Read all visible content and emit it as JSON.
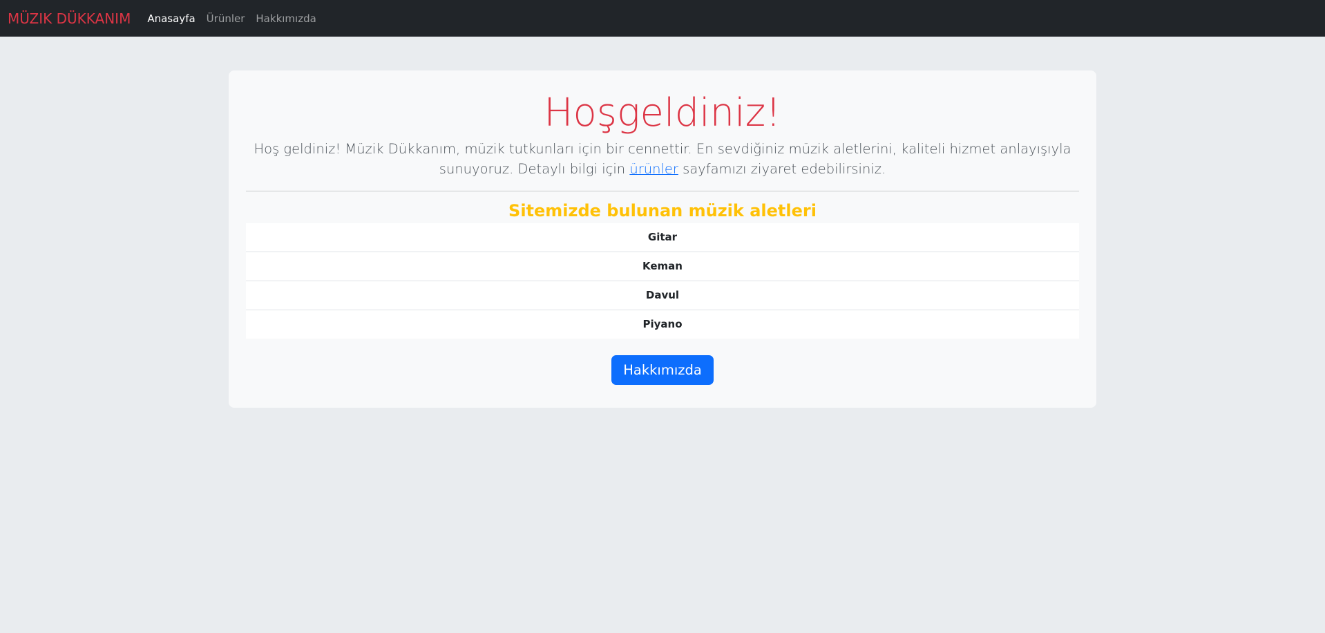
{
  "navbar": {
    "brand": "MÜZIK DÜKKANIM",
    "links": [
      "Anasayfa",
      "Ürünler",
      "Hakkımızda"
    ],
    "active": "Anasayfa"
  },
  "hero": {
    "title": "Hoşgeldiniz!",
    "lead_before": "Hoş geldiniz! Müzik Dükkanım, müzik tutkunları için bir cennettir. En sevdiğiniz müzik aletlerini, kaliteli hizmet anlayışıyla sunuyoruz. Detaylı bilgi için ",
    "lead_link": "ürünler",
    "lead_after": " sayfamızı ziyaret edebilirsiniz.",
    "section_title": "Sitemizde bulunan müzik aletleri",
    "instruments": [
      "Gitar",
      "Keman",
      "Davul",
      "Piyano"
    ],
    "button_label": "Hakkımızda"
  },
  "colors": {
    "navbar_bg": "#212529",
    "brand": "#dc3545",
    "title": "#dc3545",
    "section_title": "#ffc107",
    "button": "#0d6efd",
    "page_bg": "#e9ecef",
    "card_bg": "#f8f9fa"
  }
}
